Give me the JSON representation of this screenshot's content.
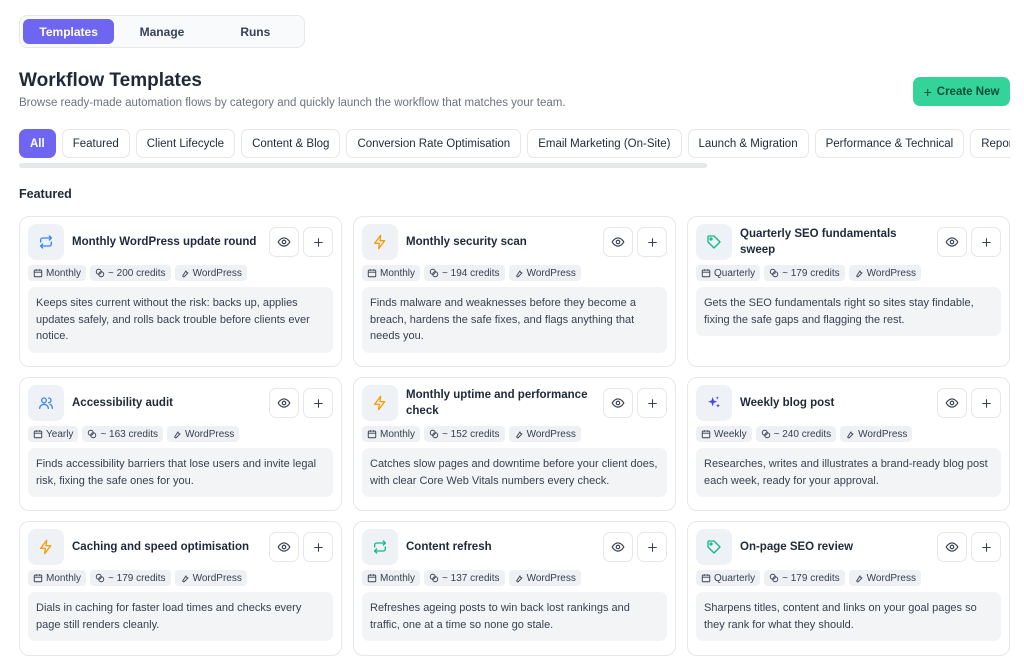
{
  "tabs": [
    {
      "label": "Templates",
      "active": true
    },
    {
      "label": "Manage",
      "active": false
    },
    {
      "label": "Runs",
      "active": false
    }
  ],
  "header": {
    "title": "Workflow Templates",
    "subtitle": "Browse ready-made automation flows by category and quickly launch the workflow that matches your team.",
    "create_label": "Create New"
  },
  "categories": [
    "All",
    "Featured",
    "Client Lifecycle",
    "Content & Blog",
    "Conversion Rate Optimisation",
    "Email Marketing (On-Site)",
    "Launch & Migration",
    "Performance & Technical",
    "Reporting"
  ],
  "section_title": "Featured",
  "colors": {
    "accent": "#6e66f0",
    "create": "#34d399",
    "blue": "#3b82f6",
    "orange": "#f59e0b",
    "green": "#10b981",
    "purple": "#4f46e5"
  },
  "cards": [
    {
      "title": "Monthly WordPress update round",
      "icon": "refresh-icon",
      "icon_color": "#3b82f6",
      "frequency": "Monthly",
      "credits": "~ 200 credits",
      "platform": "WordPress",
      "description": "Keeps sites current without the risk: backs up, applies updates safely, and rolls back trouble before clients ever notice."
    },
    {
      "title": "Monthly security scan",
      "icon": "bolt-icon",
      "icon_color": "#f59e0b",
      "frequency": "Monthly",
      "credits": "~ 194 credits",
      "platform": "WordPress",
      "description": "Finds malware and weaknesses before they become a breach, hardens the safe fixes, and flags anything that needs you."
    },
    {
      "title": "Quarterly SEO fundamentals sweep",
      "icon": "tag-icon",
      "icon_color": "#10b981",
      "frequency": "Quarterly",
      "credits": "~ 179 credits",
      "platform": "WordPress",
      "description": "Gets the SEO fundamentals right so sites stay findable, fixing the safe gaps and flagging the rest."
    },
    {
      "title": "Accessibility audit",
      "icon": "users-icon",
      "icon_color": "#3b82f6",
      "frequency": "Yearly",
      "credits": "~ 163 credits",
      "platform": "WordPress",
      "description": "Finds accessibility barriers that lose users and invite legal risk, fixing the safe ones for you."
    },
    {
      "title": "Monthly uptime and performance check",
      "icon": "bolt-icon",
      "icon_color": "#f59e0b",
      "frequency": "Monthly",
      "credits": "~ 152 credits",
      "platform": "WordPress",
      "description": "Catches slow pages and downtime before your client does, with clear Core Web Vitals numbers every check."
    },
    {
      "title": "Weekly blog post",
      "icon": "sparkles-icon",
      "icon_color": "#4f46e5",
      "frequency": "Weekly",
      "credits": "~ 240 credits",
      "platform": "WordPress",
      "description": "Researches, writes and illustrates a brand-ready blog post each week, ready for your approval."
    },
    {
      "title": "Caching and speed optimisation",
      "icon": "bolt-icon",
      "icon_color": "#f59e0b",
      "frequency": "Monthly",
      "credits": "~ 179 credits",
      "platform": "WordPress",
      "description": "Dials in caching for faster load times and checks every page still renders cleanly."
    },
    {
      "title": "Content refresh",
      "icon": "repeat-icon",
      "icon_color": "#10b981",
      "frequency": "Monthly",
      "credits": "~ 137 credits",
      "platform": "WordPress",
      "description": "Refreshes ageing posts to win back lost rankings and traffic, one at a time so none go stale."
    },
    {
      "title": "On-page SEO review",
      "icon": "tag-icon",
      "icon_color": "#10b981",
      "frequency": "Quarterly",
      "credits": "~ 179 credits",
      "platform": "WordPress",
      "description": "Sharpens titles, content and links on your goal pages so they rank for what they should."
    }
  ]
}
